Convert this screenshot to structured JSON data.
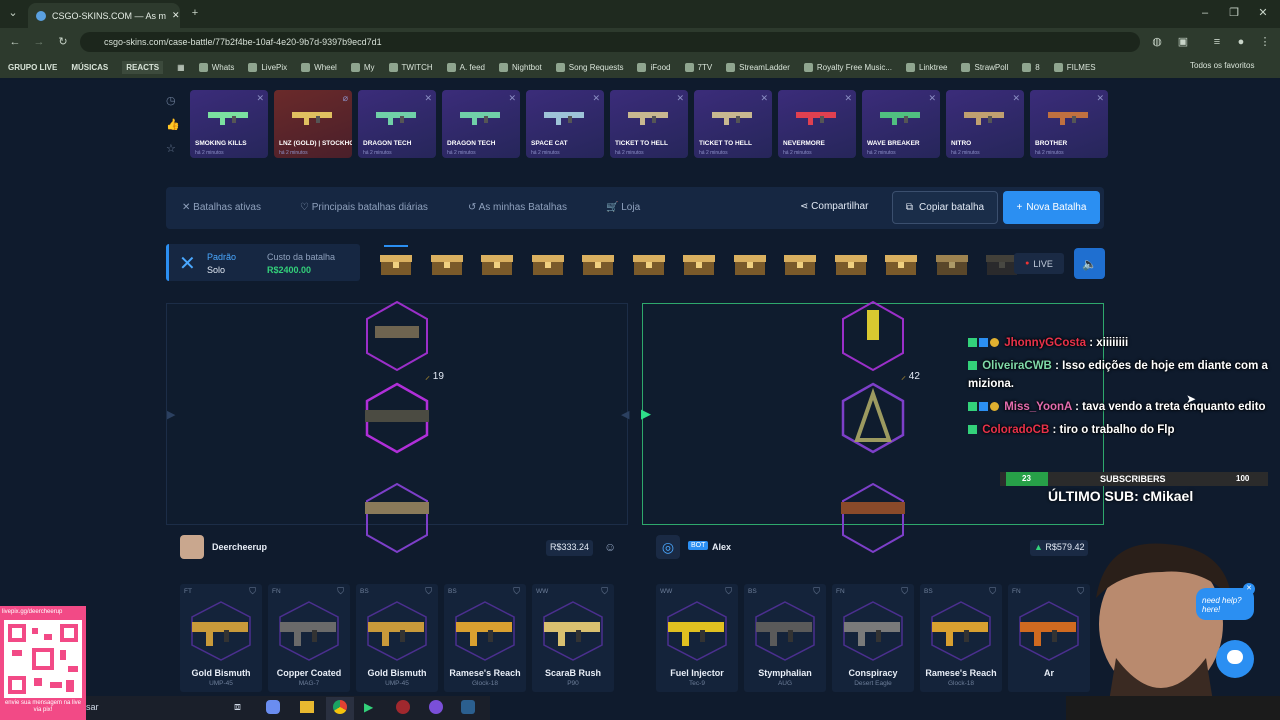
{
  "browser": {
    "tab_title": "CSGO-SKINS.COM — As m",
    "url": "csgo-skins.com/case-battle/77b2f4be-10af-4e20-9b7d-9397b9ecd7d1",
    "bookmarks": [
      "GRUPO LIVE",
      "MÚSICAS",
      "REACTS",
      "Whats",
      "LivePix",
      "Wheel",
      "My",
      "TWITCH",
      "A. feed",
      "Nightbot",
      "Song Requests",
      "iFood",
      "7TV",
      "StreamLadder",
      "Royalty Free Music...",
      "Linktree",
      "StrawPoll",
      "8",
      "FILMES"
    ],
    "all_bookmarks": "Todos os favoritos"
  },
  "drops": [
    {
      "name": "SMOKING KILLS",
      "ago": "há 2 minutos",
      "color": "#7be0a0"
    },
    {
      "name": "LNZ (GOLD) | STOCKHOLM 2021",
      "ago": "há 2 minutos",
      "color": "#e0c060"
    },
    {
      "name": "DRAGON TECH",
      "ago": "há 2 minutos",
      "color": "#70d0a8"
    },
    {
      "name": "DRAGON TECH",
      "ago": "há 2 minutos",
      "color": "#70d0a8"
    },
    {
      "name": "SPACE CAT",
      "ago": "há 2 minutos",
      "color": "#9ec4d8"
    },
    {
      "name": "TICKET TO HELL",
      "ago": "há 2 minutos",
      "color": "#c8b890"
    },
    {
      "name": "TICKET TO HELL",
      "ago": "há 2 minutos",
      "color": "#c8b890"
    },
    {
      "name": "NEVERMORE",
      "ago": "há 2 minutos",
      "color": "#e04050"
    },
    {
      "name": "WAVE BREAKER",
      "ago": "há 2 minutos",
      "color": "#50c080"
    },
    {
      "name": "NITRO",
      "ago": "há 2 minutos",
      "color": "#c0a070"
    },
    {
      "name": "BROTHER",
      "ago": "há 2 minutos",
      "color": "#c07040"
    }
  ],
  "nav": {
    "active_battles": "Batalhas ativas",
    "top_daily": "Principais batalhas diárias",
    "my_battles": "As minhas Batalhas",
    "shop": "Loja",
    "share": "Compartilhar",
    "copy": "Copiar batalha",
    "new": "Nova Batalha"
  },
  "battle": {
    "mode": "Padrão",
    "type": "Solo",
    "cost_label": "Custo da batalha",
    "cost": "R$2400.00",
    "live": "LIVE"
  },
  "reels": [
    {
      "points": "19"
    },
    {
      "points": "42"
    }
  ],
  "players": [
    {
      "name": "Deercheerup",
      "total": "R$333.24",
      "bot": false,
      "items": [
        {
          "grade": "FT",
          "name": "Gold Bismuth",
          "weapon": "UMP-45"
        },
        {
          "grade": "FN",
          "name": "Copper Coated",
          "weapon": "MAG-7"
        },
        {
          "grade": "BS",
          "name": "Gold Bismuth",
          "weapon": "UMP-45"
        },
        {
          "grade": "BS",
          "name": "Ramese's Reach",
          "weapon": "Glock-18"
        },
        {
          "grade": "WW",
          "name": "ScaraB Rush",
          "weapon": "P90"
        }
      ]
    },
    {
      "name": "Alex",
      "total": "R$579.42",
      "bot": true,
      "bot_label": "BOT",
      "items": [
        {
          "grade": "WW",
          "name": "Fuel Injector",
          "weapon": "Tec-9"
        },
        {
          "grade": "BS",
          "name": "Stymphalian",
          "weapon": "AUG"
        },
        {
          "grade": "FN",
          "name": "Conspiracy",
          "weapon": "Desert Eagle"
        },
        {
          "grade": "BS",
          "name": "Ramese's Reach",
          "weapon": "Glock-18"
        },
        {
          "grade": "FN",
          "name": "Ar",
          "weapon": ""
        }
      ]
    }
  ],
  "stream": {
    "chat": [
      {
        "user": "JhonnyGCosta",
        "user_color": "#e8324a",
        "msg": ": xiiiiiiii"
      },
      {
        "user": "OliveiraCWB",
        "user_color": "#7fd9a8",
        "msg": ": Isso edições de hoje em diante com a miziona."
      },
      {
        "user": "Miss_YoonA",
        "user_color": "#e36cae",
        "msg": ": tava vendo a treta enquanto edito"
      },
      {
        "user": "ColoradoCB",
        "user_color": "#e8324a",
        "msg": ": tiro o trabalho do Flp"
      }
    ],
    "sub_current": "23",
    "sub_label": "SUBSCRIBERS",
    "sub_goal": "100",
    "sub_progress": 0.23,
    "last_sub": "ÚLTIMO SUB: cMikael",
    "qr_top": "livepix.gg/deercheerup",
    "qr_bottom": "envie sua mensagem na live via pix!",
    "help": "need help? here!"
  },
  "taskbar": {
    "search": "sar"
  }
}
